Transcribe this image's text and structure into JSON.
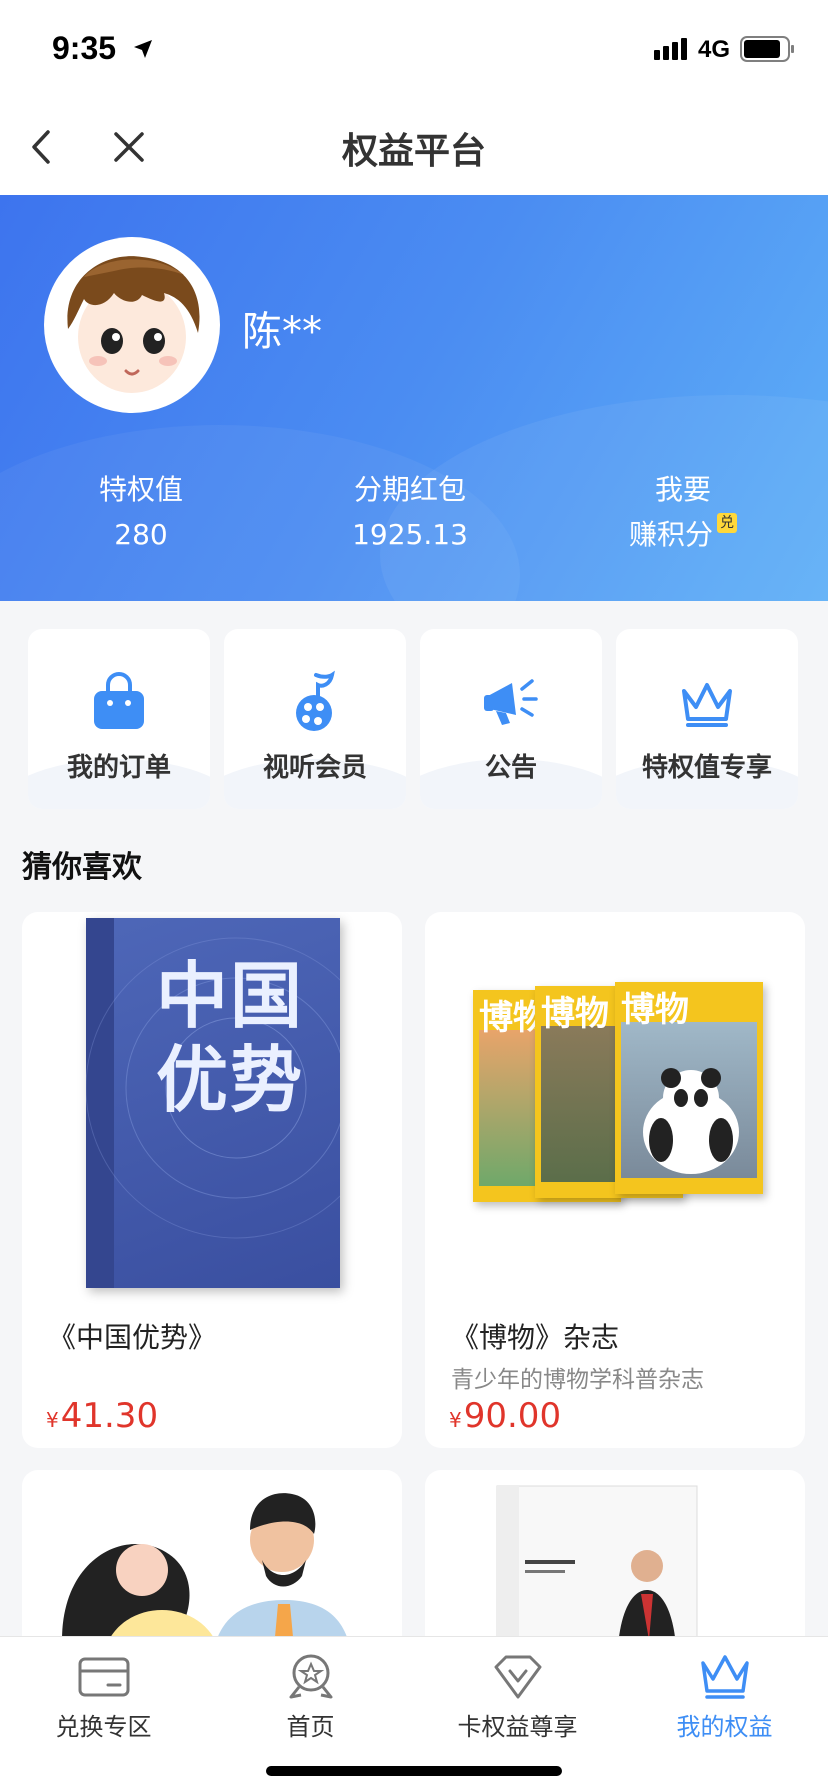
{
  "status_bar": {
    "time": "9:35",
    "network": "4G"
  },
  "nav": {
    "title": "权益平台"
  },
  "user": {
    "name": "陈**"
  },
  "stats": [
    {
      "label": "特权值",
      "value": "280"
    },
    {
      "label": "分期红包",
      "value": "1925.13"
    },
    {
      "label": "我要",
      "value": "赚积分",
      "badge": "兑"
    }
  ],
  "quick_actions": [
    {
      "label": "我的订单",
      "icon": "shopping-bag-icon"
    },
    {
      "label": "视听会员",
      "icon": "music-film-icon"
    },
    {
      "label": "公告",
      "icon": "megaphone-icon"
    },
    {
      "label": "特权值专享",
      "icon": "crown-icon"
    }
  ],
  "recommend": {
    "title": "猜你喜欢",
    "products": [
      {
        "name": "《中国优势》",
        "subtitle": "",
        "currency": "¥",
        "price": "41.30",
        "cover_title": "中国优势"
      },
      {
        "name": "《博物》杂志",
        "subtitle": "青少年的博物学科普杂志",
        "currency": "¥",
        "price": "90.00",
        "cover_title": "博物"
      }
    ]
  },
  "tabs": [
    {
      "label": "兑换专区",
      "icon": "card-icon",
      "active": false
    },
    {
      "label": "首页",
      "icon": "star-badge-icon",
      "active": false
    },
    {
      "label": "卡权益尊享",
      "icon": "diamond-icon",
      "active": false
    },
    {
      "label": "我的权益",
      "icon": "crown-icon",
      "active": true
    }
  ],
  "colors": {
    "brand_blue": "#3e8ef5",
    "price_red": "#e0352b",
    "badge_yellow": "#ffd83a"
  }
}
